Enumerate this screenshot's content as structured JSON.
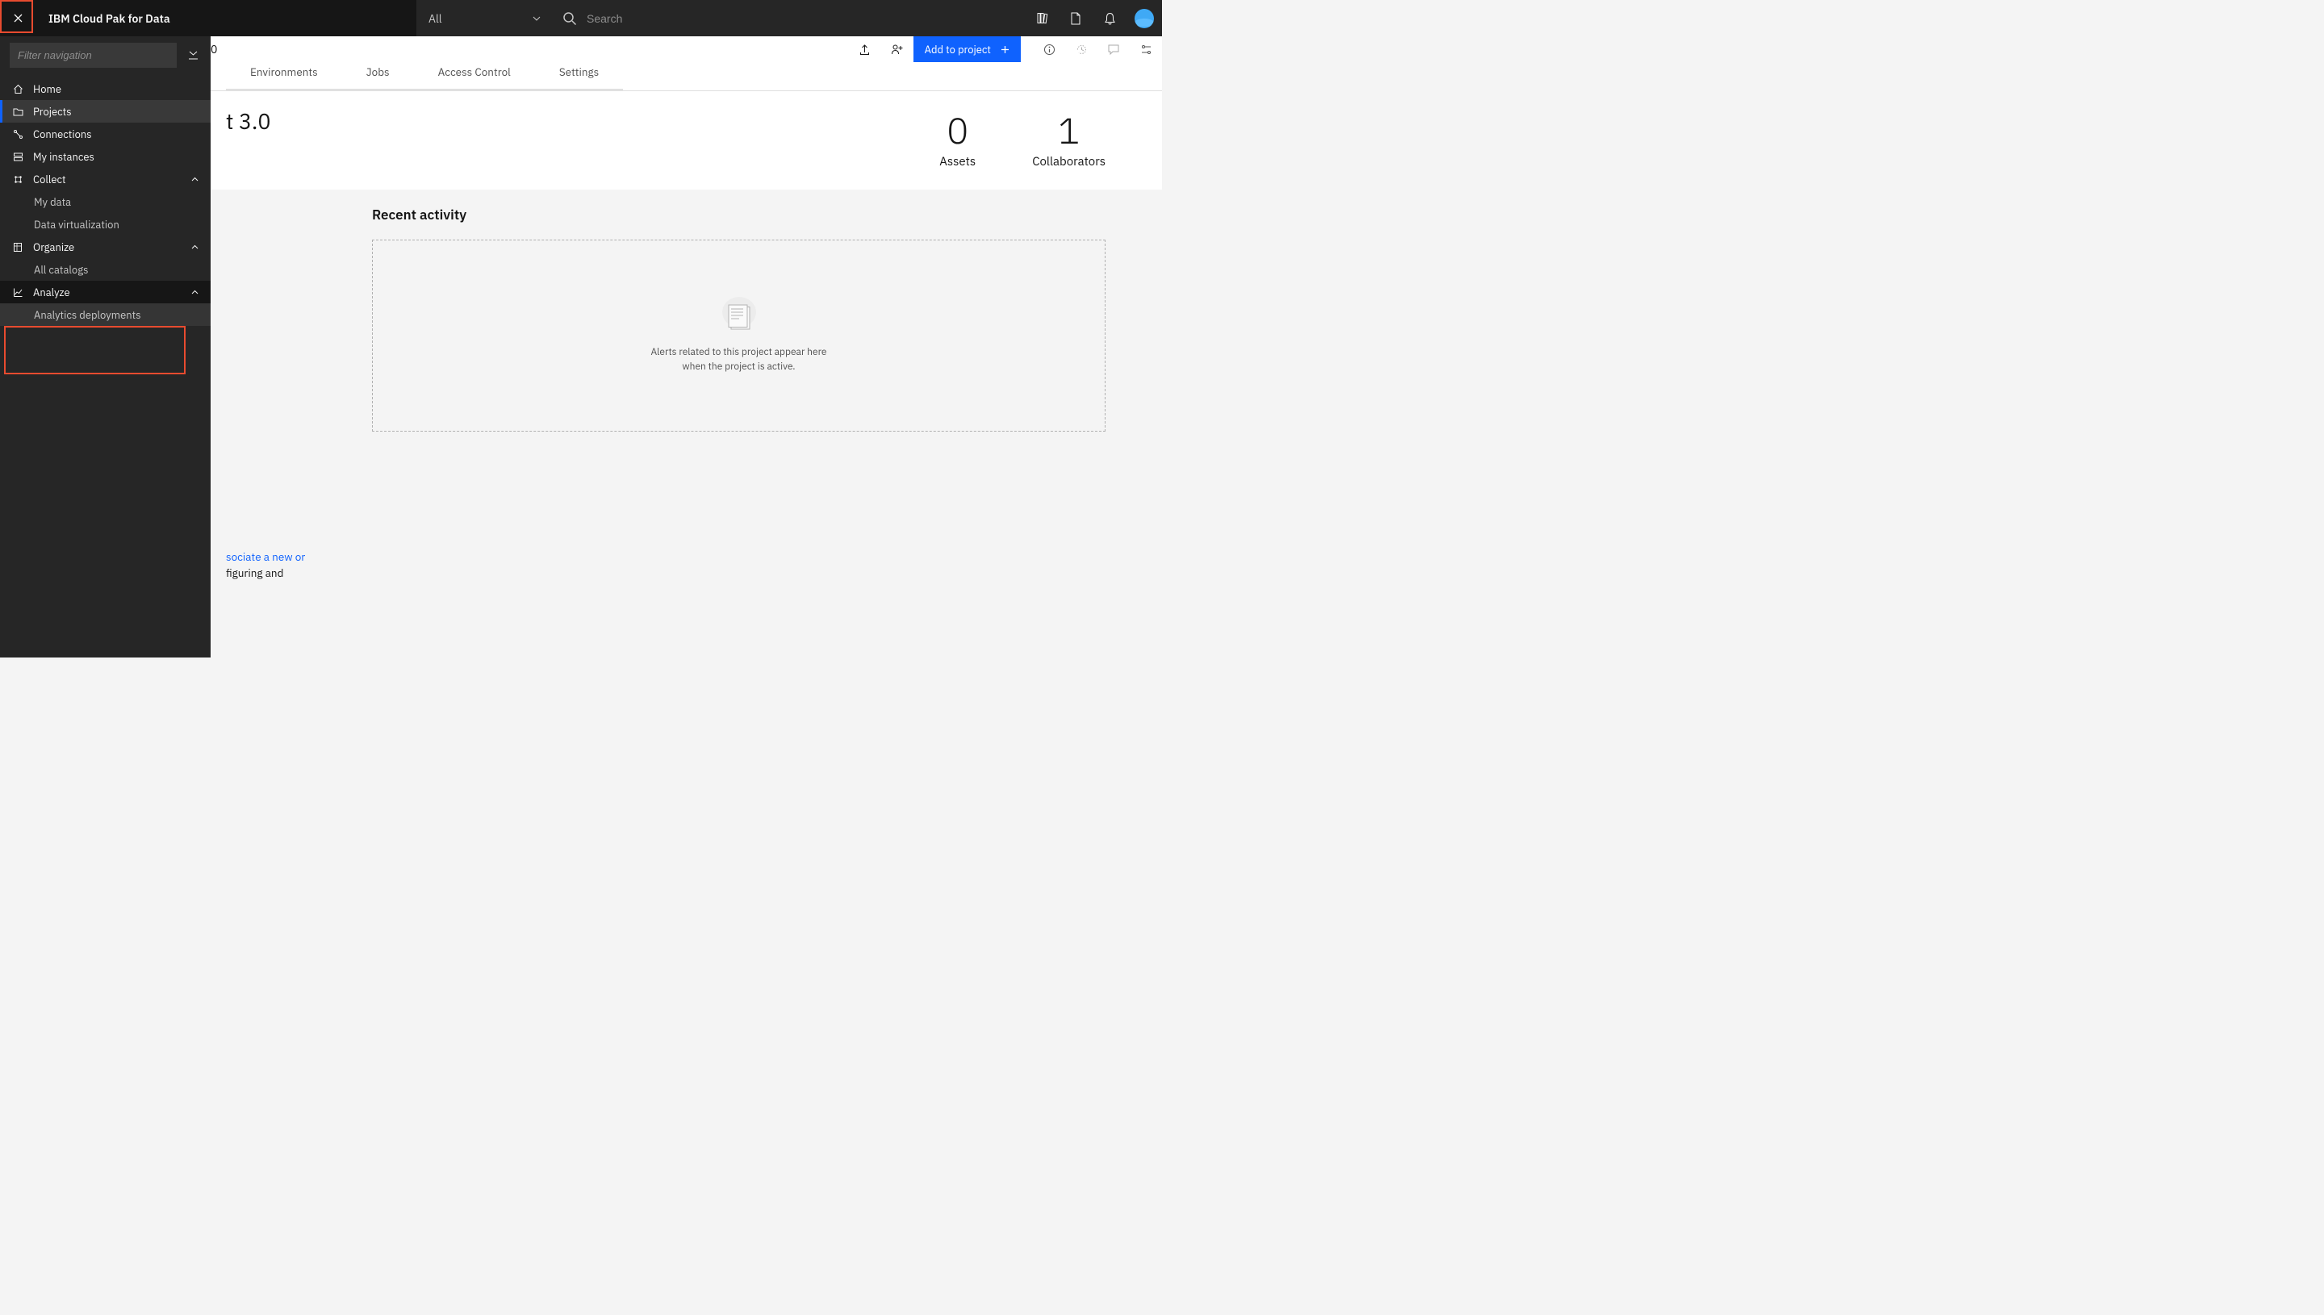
{
  "header": {
    "app_title": "IBM Cloud Pak for Data",
    "scope_label": "All",
    "search_placeholder": "Search"
  },
  "sidebar": {
    "filter_placeholder": "Filter navigation",
    "items": [
      {
        "label": "Home"
      },
      {
        "label": "Projects"
      },
      {
        "label": "Connections"
      },
      {
        "label": "My instances"
      },
      {
        "label": "Collect"
      },
      {
        "label": "My data"
      },
      {
        "label": "Data virtualization"
      },
      {
        "label": "Organize"
      },
      {
        "label": "All catalogs"
      },
      {
        "label": "Analyze"
      },
      {
        "label": "Analytics deployments"
      }
    ]
  },
  "toolbar": {
    "left_suffix": "0",
    "add_label": "Add to project"
  },
  "tabs": [
    {
      "label": "Environments"
    },
    {
      "label": "Jobs"
    },
    {
      "label": "Access Control"
    },
    {
      "label": "Settings"
    }
  ],
  "hero": {
    "title_suffix": "t 3.0",
    "stats": [
      {
        "value": "0",
        "label": "Assets"
      },
      {
        "value": "1",
        "label": "Collaborators"
      }
    ]
  },
  "below": {
    "associate_link": "sociate a new or",
    "associate_tail": "figuring and"
  },
  "recent": {
    "title": "Recent activity",
    "empty_line1": "Alerts related to this project appear here",
    "empty_line2": "when the project is active."
  }
}
